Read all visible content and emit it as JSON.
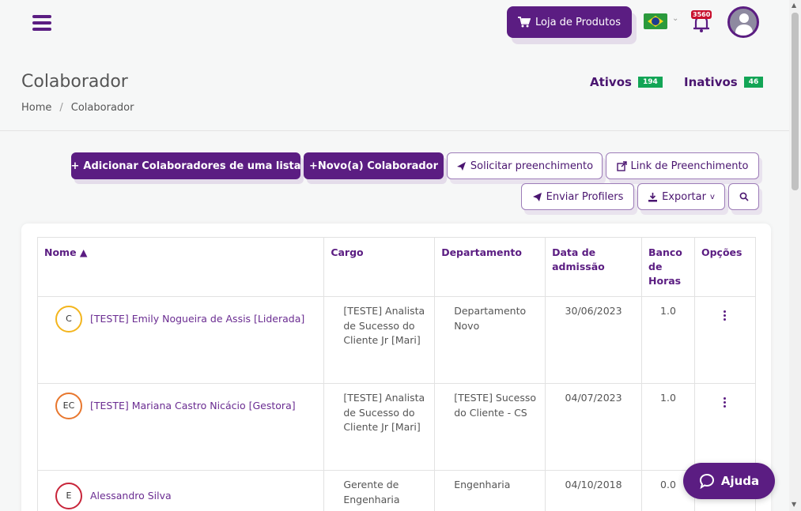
{
  "header": {
    "shop_label": "Loja de Produtos",
    "notification_count": "3560",
    "language": "pt-BR"
  },
  "page": {
    "title": "Colaborador",
    "breadcrumb": [
      "Home",
      "Colaborador"
    ],
    "active_label": "Ativos",
    "active_count": "194",
    "inactive_label": "Inativos",
    "inactive_count": "46"
  },
  "toolbar": {
    "add_list": "Adicionar Colaboradores de uma lista",
    "new": "+Novo(a) Colaborador",
    "request_fill": "Solicitar preenchimento",
    "fill_link": "Link de Preenchimento",
    "send_profilers": "Enviar Profilers",
    "export": "Exportar"
  },
  "table": {
    "headers": {
      "name": "Nome ▲",
      "role": "Cargo",
      "department": "Departamento",
      "admission": "Data de admissão",
      "hours": "Banco de Horas",
      "options": "Opções"
    },
    "rows": [
      {
        "initials": "C",
        "name": "[TESTE] Emily Nogueira de Assis [Liderada]",
        "role": "[TESTE] Analista de Sucesso do Cliente Jr [Mari]",
        "department": "Departamento Novo",
        "admission": "30/06/2023",
        "hours": "1.0",
        "ring": "#f3b51d"
      },
      {
        "initials": "EC",
        "name": "[TESTE] Mariana Castro Nicácio [Gestora]",
        "role": "[TESTE] Analista de Sucesso do Cliente Jr [Mari]",
        "department": "[TESTE] Sucesso do Cliente - CS",
        "admission": "04/07/2023",
        "hours": "1.0",
        "ring": "#e8772e"
      },
      {
        "initials": "E",
        "name": "Alessandro Silva",
        "role": "Gerente de Engenharia",
        "department": "Engenharia",
        "admission": "04/10/2018",
        "hours": "0.0",
        "ring": "#c8253a"
      }
    ]
  },
  "help_label": "Ajuda",
  "colors": {
    "brand": "#5b1d82",
    "badge": "#13a556"
  }
}
